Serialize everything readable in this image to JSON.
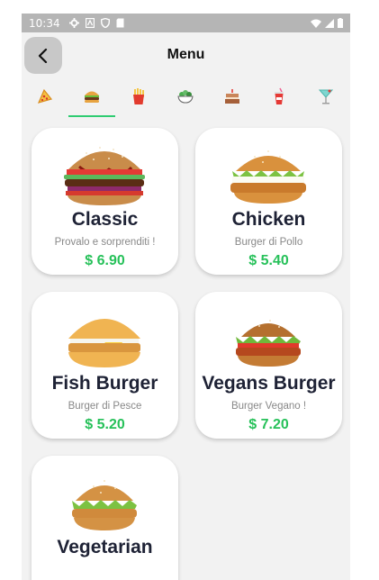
{
  "status": {
    "time": "10:34"
  },
  "header": {
    "title": "Menu"
  },
  "categories": [
    {
      "name": "pizza-icon"
    },
    {
      "name": "burger-icon",
      "selected": true
    },
    {
      "name": "fries-icon"
    },
    {
      "name": "salad-icon"
    },
    {
      "name": "cake-icon"
    },
    {
      "name": "drink-icon"
    },
    {
      "name": "cocktail-icon"
    }
  ],
  "items": [
    {
      "name": "Classic",
      "subtitle": "Provalo e sorprenditi !",
      "price": "$ 6.90"
    },
    {
      "name": "Chicken",
      "subtitle": "Burger di Pollo",
      "price": "$ 5.40"
    },
    {
      "name": "Fish Burger",
      "subtitle": "Burger di Pesce",
      "price": "$ 5.20"
    },
    {
      "name": "Vegans Burger",
      "subtitle": "Burger Vegano !",
      "price": "$ 7.20"
    },
    {
      "name": "Vegetarian",
      "subtitle": "",
      "price": ""
    }
  ],
  "colors": {
    "accent": "#2ecc71",
    "price": "#27c15a",
    "background": "#f2f2f2"
  }
}
